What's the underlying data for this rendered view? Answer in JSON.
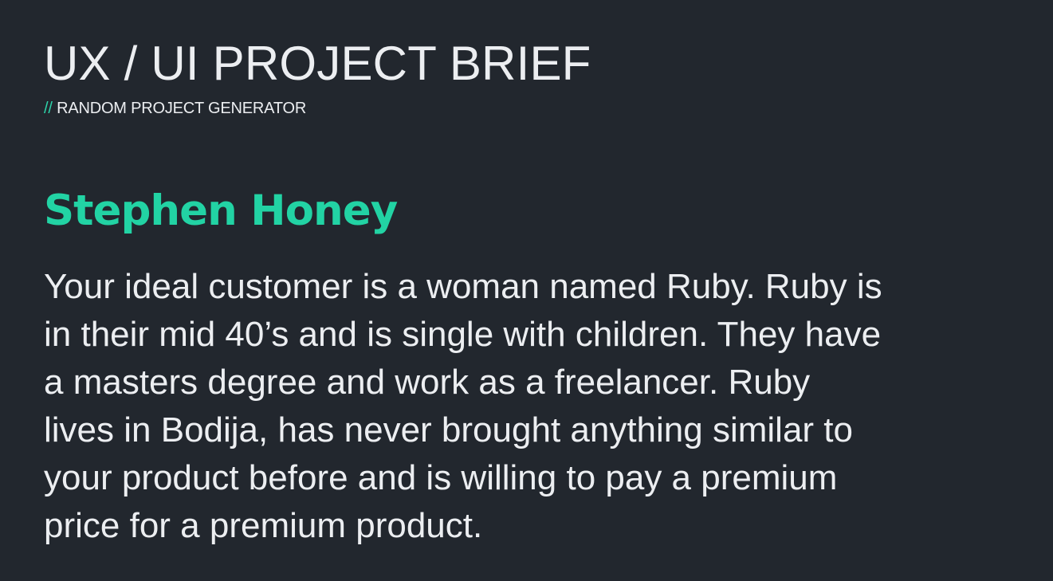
{
  "header": {
    "title": "UX / UI PROJECT BRIEF",
    "subtitle_prefix": "//",
    "subtitle": "RANDOM PROJECT GENERATOR"
  },
  "project": {
    "name": "Stephen Honey",
    "brief_lines": [
      "Your ideal customer is a woman named Ruby. Ruby is",
      "in their mid 40’s and is single with children. They have",
      "a masters degree and work as a freelancer. Ruby",
      "lives in Bodija, has never brought anything similar to",
      "your product before and is willing to pay a premium",
      "price for a premium product."
    ]
  },
  "colors": {
    "background": "#22272e",
    "text": "#eceef1",
    "accent": "#22d3a4"
  }
}
